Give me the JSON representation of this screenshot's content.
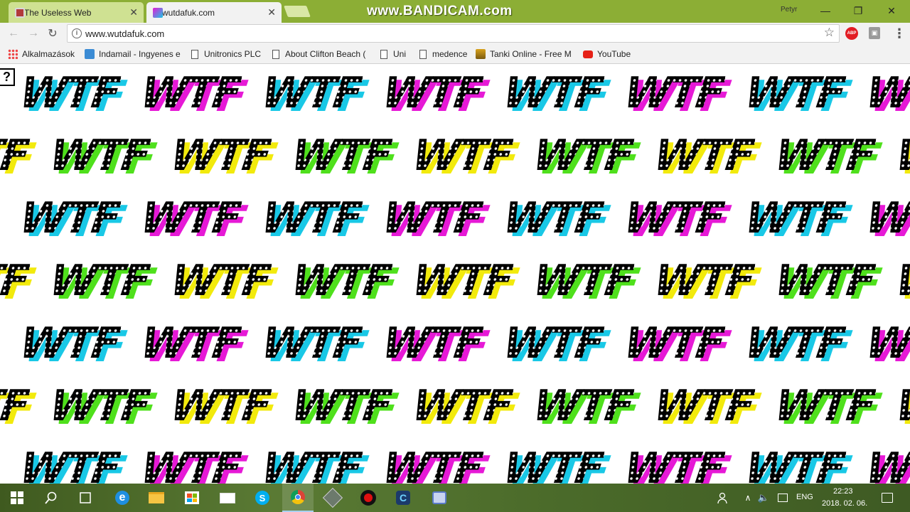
{
  "browser": {
    "tabs": [
      {
        "title": "The Useless Web",
        "active": false
      },
      {
        "title": "wutdafuk.com",
        "active": true
      }
    ],
    "overlay_watermark": "www.BANDICAM.com",
    "profile_name": "Petyr",
    "url": "www.wutdafuk.com",
    "extensions": [
      "ABP",
      "Ext"
    ]
  },
  "bookmarks": [
    {
      "label": "Alkalmazások",
      "icon": "apps-grid-icon"
    },
    {
      "label": "Indamail - Ingyenes e",
      "icon": "mail-icon"
    },
    {
      "label": "Unitronics PLC",
      "icon": "page-icon"
    },
    {
      "label": "About Clifton Beach (",
      "icon": "page-icon"
    },
    {
      "label": "Uni",
      "icon": "page-icon"
    },
    {
      "label": "medence",
      "icon": "page-icon"
    },
    {
      "label": "Tanki Online - Free M",
      "icon": "tank-icon"
    },
    {
      "label": "YouTube",
      "icon": "youtube-icon"
    }
  ],
  "page": {
    "help_symbol": "?",
    "tile_text": "WTF",
    "shadow_colors": [
      "#19c8e6",
      "#e619d6",
      "#f2ea0c",
      "#4fe01c"
    ]
  },
  "taskbar": {
    "language": "ENG",
    "time": "22:23",
    "date": "2018. 02. 06."
  }
}
